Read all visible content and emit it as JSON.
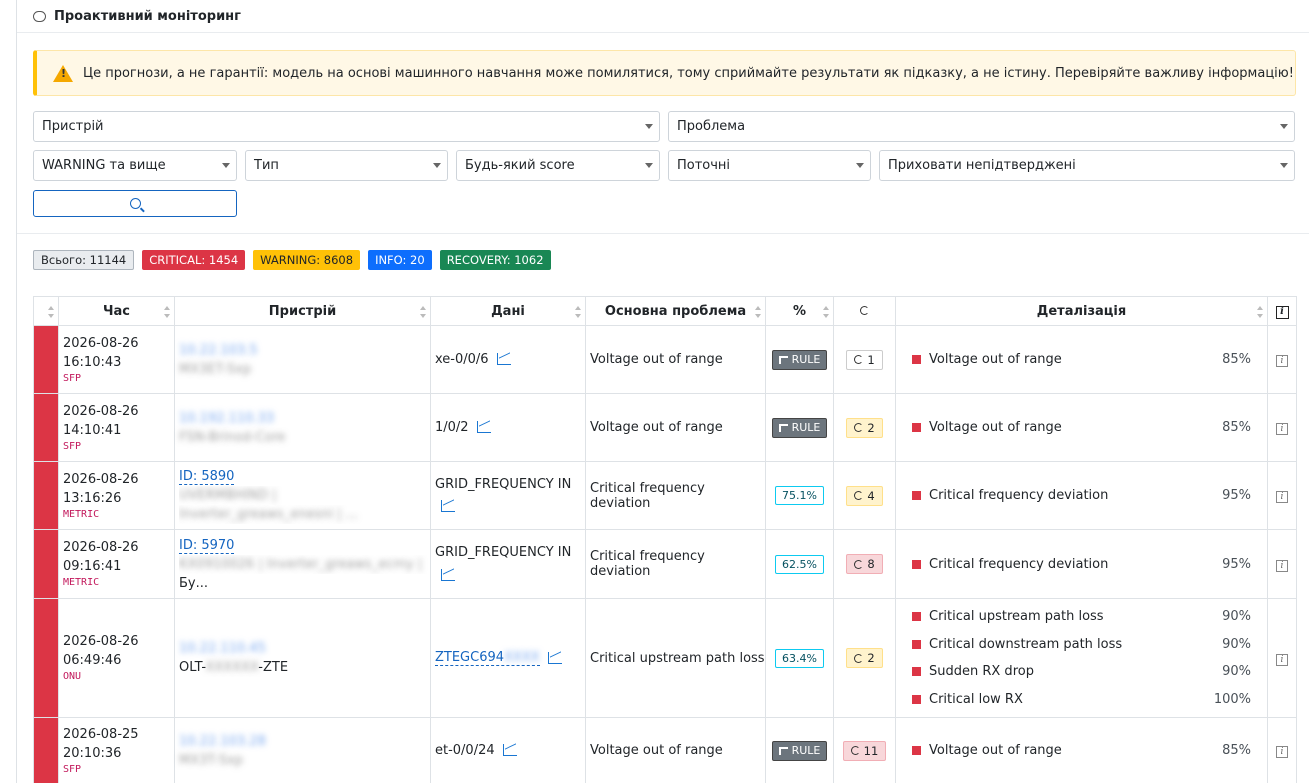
{
  "header": {
    "title": "Проактивний моніторинг"
  },
  "alert": {
    "text": "Це прогнози, а не гарантії: модель на основі машинного навчання може помилятися, тому сприймайте результати як підказку, а не істину. Перевіряйте важливу інформацію!"
  },
  "filters": {
    "device": "Пристрій",
    "problem": "Проблема",
    "severity": "WARNING та вище",
    "type": "Тип",
    "score": "Будь-який score",
    "period": "Поточні",
    "confirm": "Приховати непідтверджені"
  },
  "badges": {
    "total": "Всього: 11144",
    "critical": "CRITICAL: 1454",
    "warning": "WARNING: 8608",
    "info": "INFO: 20",
    "recovery": "RECOVERY: 1062"
  },
  "columns": {
    "time": "Час",
    "device": "Пристрій",
    "data": "Дані",
    "problem": "Основна проблема",
    "pct": "%",
    "detail": "Деталізація"
  },
  "rows": [
    {
      "date": "2026-08-26",
      "time": "16:10:43",
      "src": "SFP",
      "dev1": "10.22.103.5",
      "dev2": "MX3ET-Sxp",
      "data": "xe-0/0/6",
      "problem": "Voltage out of range",
      "rule": "RULE",
      "cnt": "1",
      "cntc": "",
      "det": [
        {
          "t": "Voltage out of range",
          "p": "85%"
        }
      ]
    },
    {
      "date": "2026-08-26",
      "time": "14:10:41",
      "src": "SFP",
      "dev1": "10.192.110.33",
      "dev2": "FSN-Brinod-Core",
      "data": "1/0/2",
      "problem": "Voltage out of range",
      "rule": "RULE",
      "cnt": "2",
      "cntc": "y",
      "det": [
        {
          "t": "Voltage out of range",
          "p": "85%"
        }
      ]
    },
    {
      "date": "2026-08-26",
      "time": "13:16:26",
      "src": "METRIC",
      "dev1": "ID: 5890",
      "dev2": "UVERMBHIND |",
      "dev3": "Inverter_greaws_enesni | ...",
      "data": "GRID_FREQUENCY IN",
      "problem": "Critical frequency deviation",
      "pv": "75.1%",
      "cnt": "4",
      "cntc": "y",
      "det": [
        {
          "t": "Critical frequency deviation",
          "p": "95%"
        }
      ]
    },
    {
      "date": "2026-08-26",
      "time": "09:16:41",
      "src": "METRIC",
      "dev1": "ID: 5970",
      "dev2": "KX0910026 | Inverter_greaws_ecmy |",
      "dev3": "Бу...",
      "data": "GRID_FREQUENCY IN",
      "problem": "Critical frequency deviation",
      "pv": "62.5%",
      "cnt": "8",
      "cntc": "r",
      "det": [
        {
          "t": "Critical frequency deviation",
          "p": "95%"
        }
      ]
    },
    {
      "date": "2026-08-26",
      "time": "06:49:46",
      "src": "ONU",
      "dev1": "10.22.110.45",
      "dev2": "OLT-",
      "dev2b": "XXXXXX",
      "dev2c": "-ZTE",
      "data": "ZTEGC694",
      "datab": "XXXX",
      "problem": "Critical upstream path loss",
      "pv": "63.4%",
      "cnt": "2",
      "cntc": "y",
      "det": [
        {
          "t": "Critical upstream path loss",
          "p": "90%"
        },
        {
          "t": "Critical downstream path loss",
          "p": "90%"
        },
        {
          "t": "Sudden RX drop",
          "p": "90%"
        },
        {
          "t": "Critical low RX",
          "p": "100%"
        }
      ]
    },
    {
      "date": "2026-08-25",
      "time": "20:10:36",
      "src": "SFP",
      "dev1": "10.22.103.28",
      "dev2": "MX3T-Sxp",
      "data": "et-0/0/24",
      "problem": "Voltage out of range",
      "rule": "RULE",
      "cnt": "11",
      "cntc": "r",
      "det": [
        {
          "t": "Voltage out of range",
          "p": "85%"
        }
      ]
    }
  ],
  "colors": {
    "critical": "#dc3545",
    "warning": "#ffc107",
    "info": "#0d6efd",
    "recovery": "#198754",
    "total": "#e9ecef"
  }
}
